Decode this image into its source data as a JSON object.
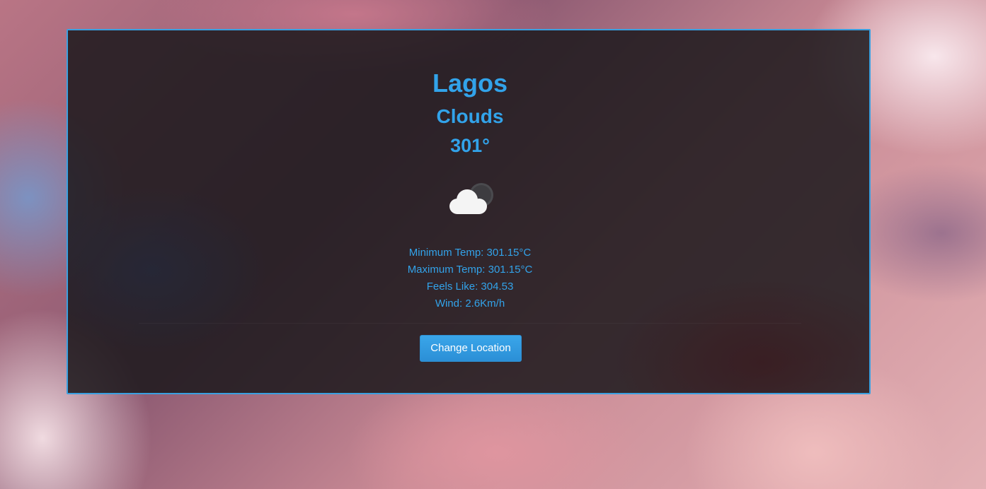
{
  "weather": {
    "city": "Lagos",
    "condition": "Clouds",
    "temperature": "301°",
    "icon": "cloud-icon"
  },
  "details": {
    "min_temp": "Minimum Temp: 301.15°C",
    "max_temp": "Maximum Temp: 301.15°C",
    "feels_like": "Feels Like: 304.53",
    "wind": "Wind: 2.6Km/h"
  },
  "actions": {
    "change_location_label": "Change Location"
  },
  "colors": {
    "accent": "#32a3ea",
    "button": "#2f97dd",
    "border": "#3aa0e0"
  }
}
